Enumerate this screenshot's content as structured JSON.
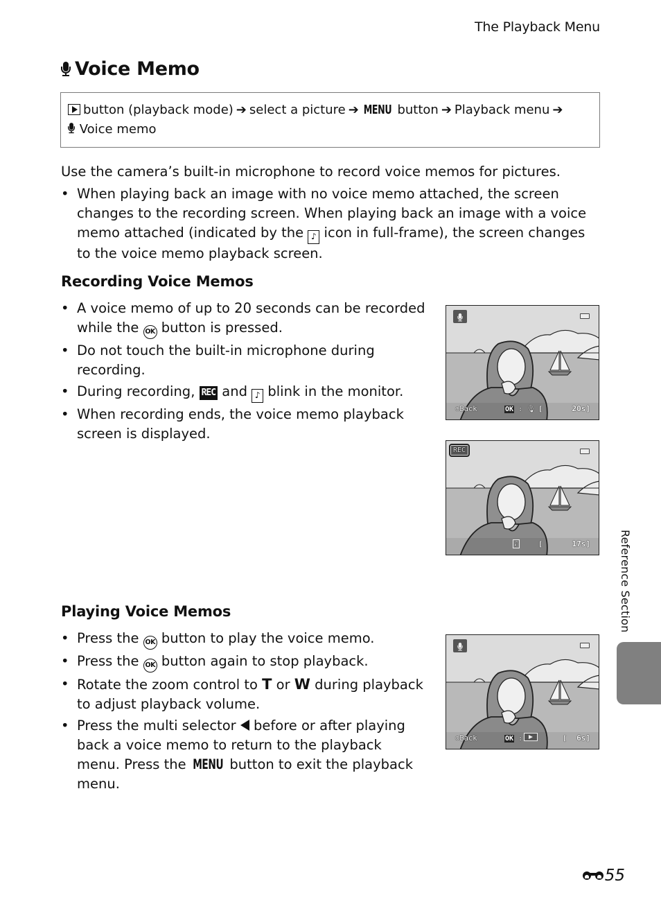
{
  "header": {
    "section_title": "The Playback Menu"
  },
  "title": {
    "icon": "microphone-icon",
    "text": "Voice Memo"
  },
  "nav_path": {
    "line1": [
      {
        "type": "icon",
        "name": "playback-button-icon"
      },
      {
        "type": "text",
        "value": "button (playback mode)"
      },
      {
        "type": "arrow",
        "value": "➔"
      },
      {
        "type": "text",
        "value": "select a picture"
      },
      {
        "type": "arrow",
        "value": "➔"
      },
      {
        "type": "glyph",
        "value": "MENU"
      },
      {
        "type": "text",
        "value": "button"
      },
      {
        "type": "arrow",
        "value": "➔"
      },
      {
        "type": "text",
        "value": "Playback menu"
      },
      {
        "type": "arrow",
        "value": "➔"
      }
    ],
    "line2_icon": "microphone-icon",
    "line2_text": "Voice memo"
  },
  "intro": {
    "text": "Use the camera’s built-in microphone to record voice memos for pictures.",
    "bullets": [
      {
        "a": "When playing back an image with no voice memo attached, the screen changes to the recording screen. When playing back an image with a voice memo attached (indicated by the ",
        "icon": "voice-memo-note-icon",
        "b": " icon in full-frame), the screen changes to the voice memo playback screen."
      }
    ]
  },
  "recording": {
    "heading": "Recording Voice Memos",
    "bullets": [
      {
        "a": "A voice memo of up to 20 seconds can be recorded while the ",
        "glyph": "OK",
        "b": " button is pressed."
      },
      {
        "a": "Do not touch the built-in microphone during recording."
      },
      {
        "a": "During recording, ",
        "glyph": "REC",
        "b": " and ",
        "glyph2": "♪",
        "c": " blink in the monitor."
      },
      {
        "a": "When recording ends, the voice memo playback screen is displayed."
      }
    ]
  },
  "playing": {
    "heading": "Playing Voice Memos",
    "bullets": [
      {
        "a": "Press the ",
        "glyph": "OK",
        "b": " button to play the voice memo."
      },
      {
        "a": "Press the ",
        "glyph": "OK",
        "b": " button again to stop playback."
      },
      {
        "a": "Rotate the zoom control to ",
        "t": "T",
        "or": " or ",
        "w": "W",
        "b": " during playback to adjust playback volume."
      },
      {
        "a": "Press the multi selector ",
        "b": " before or after playing back a voice memo to return to the playback menu. Press the ",
        "menu": "MENU",
        "c": " button to exit the playback menu."
      }
    ]
  },
  "screens": [
    {
      "state": "recording-ready",
      "mode": "microphone-icon",
      "back_label": "Back",
      "ok_label": "OK",
      "ok_action": "microphone",
      "time": "20s"
    },
    {
      "state": "recording",
      "rec_label": "REC",
      "time": "17s"
    },
    {
      "state": "playback",
      "mode": "microphone-icon",
      "back_label": "Back",
      "ok_label": "OK",
      "ok_action": "play",
      "time": "6s"
    }
  ],
  "side_tab": {
    "label": "Reference Section",
    "color": "#808080"
  },
  "footer": {
    "page_prefix_icon": "binoculars-icon",
    "page_number": "55"
  }
}
